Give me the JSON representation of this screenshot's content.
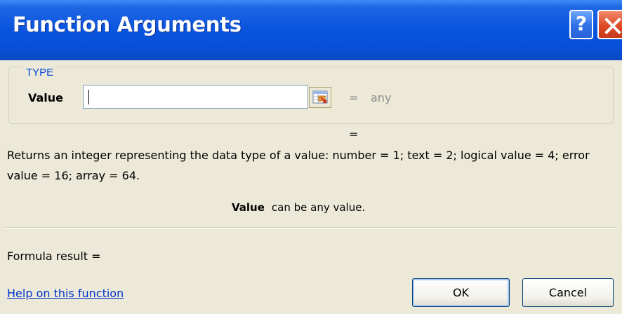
{
  "window": {
    "title": "Function Arguments",
    "help_glyph": "?"
  },
  "group": {
    "legend": "TYPE"
  },
  "argument": {
    "label": "Value",
    "input_value": "",
    "equals": "=",
    "evaluated": "any"
  },
  "result_equals": "=",
  "description": "Returns an integer representing the data type of a value: number = 1; text = 2; logical value = 4; error value = 16; array = 64.",
  "arg_help": {
    "name": "Value",
    "text": "can be any value."
  },
  "formula_result": {
    "label": "Formula result ="
  },
  "links": {
    "help": "Help on this function"
  },
  "buttons": {
    "ok": "OK",
    "cancel": "Cancel"
  },
  "colors": {
    "titlebar": "#0a54de",
    "dialog_bg": "#ece9d8",
    "legend": "#0046d5",
    "link": "#0033cc",
    "close": "#dd4b27"
  }
}
